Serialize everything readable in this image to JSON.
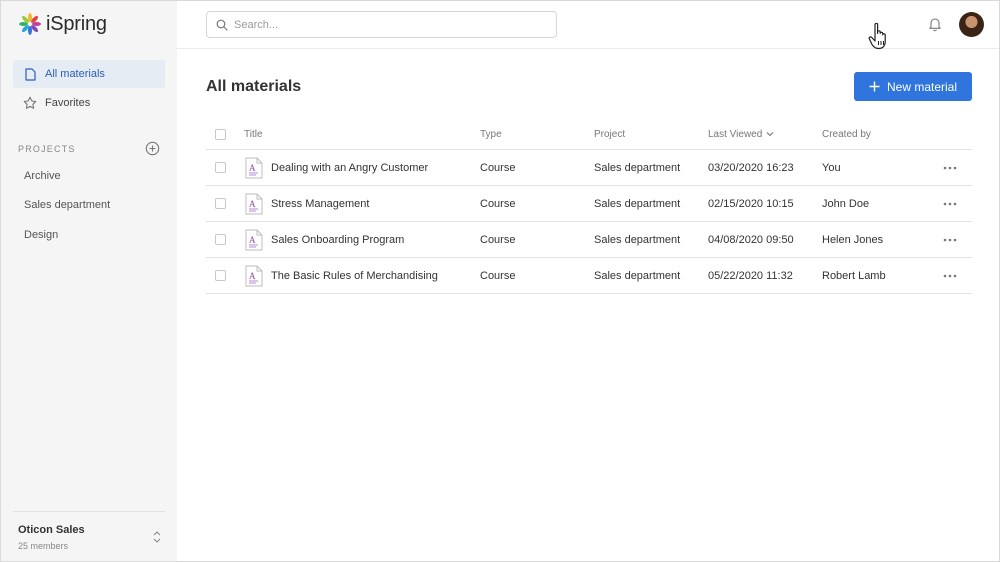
{
  "app": {
    "name": "iSpring"
  },
  "sidebar": {
    "nav": [
      {
        "label": "All materials",
        "icon": "document-icon",
        "active": true
      },
      {
        "label": "Favorites",
        "icon": "star-icon",
        "active": false
      }
    ],
    "projects_label": "PROJECTS",
    "projects": [
      "Archive",
      "Sales department",
      "Design"
    ],
    "team": {
      "name": "Oticon Sales",
      "members": "25 members"
    }
  },
  "topbar": {
    "search_placeholder": "Search..."
  },
  "main": {
    "title": "All materials",
    "new_button": "New material",
    "columns": {
      "title": "Title",
      "type": "Type",
      "project": "Project",
      "last_viewed": "Last Viewed",
      "created_by": "Created by"
    },
    "rows": [
      {
        "title": "Dealing with an Angry Customer",
        "type": "Course",
        "project": "Sales department",
        "last_viewed": "03/20/2020 16:23",
        "created_by": "You"
      },
      {
        "title": "Stress Management",
        "type": "Course",
        "project": "Sales department",
        "last_viewed": "02/15/2020 10:15",
        "created_by": "John Doe"
      },
      {
        "title": "Sales Onboarding Program",
        "type": "Course",
        "project": "Sales department",
        "last_viewed": "04/08/2020 09:50",
        "created_by": "Helen Jones"
      },
      {
        "title": "The Basic Rules of Merchandising",
        "type": "Course",
        "project": "Sales department",
        "last_viewed": "05/22/2020 11:32",
        "created_by": "Robert Lamb"
      }
    ]
  },
  "colors": {
    "accent": "#2f75dd",
    "active_nav_bg": "#e6ecf4",
    "sidebar_bg": "#f5f5f5"
  }
}
